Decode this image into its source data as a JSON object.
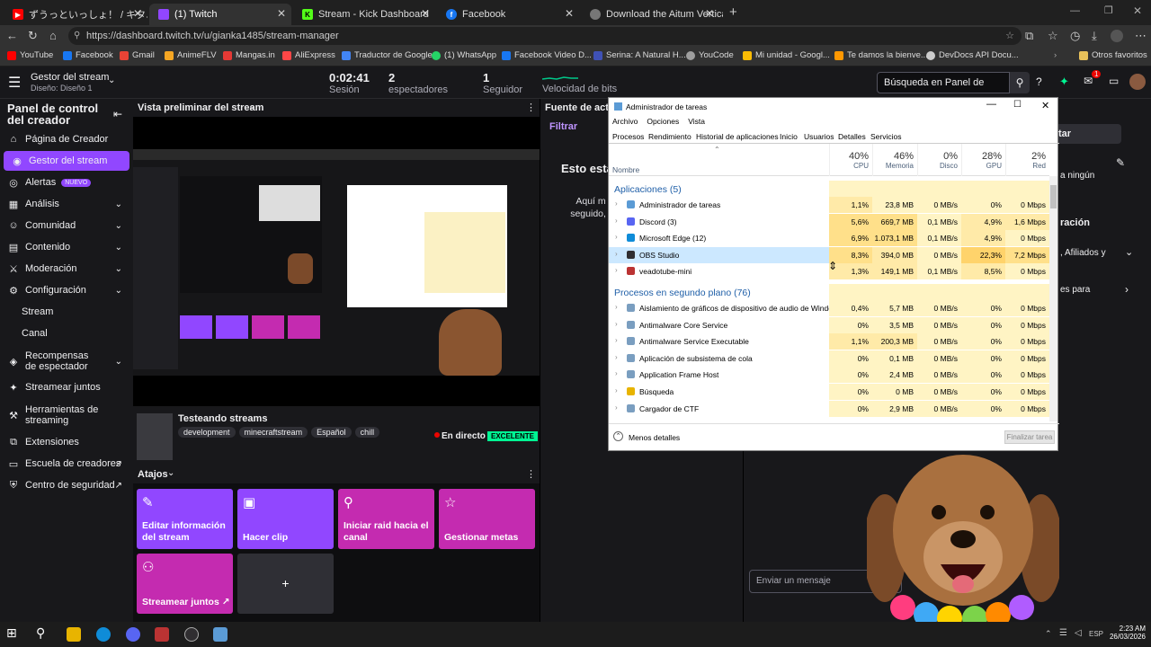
{
  "browser": {
    "tabs": [
      {
        "label": "ずうっといっしょ！ / キタニタツヤ - ALW",
        "color": "#ff0000"
      },
      {
        "label": "(1) Twitch",
        "color": "#9146ff"
      },
      {
        "label": "Stream - Kick Dashboard",
        "color": "#53fc18"
      },
      {
        "label": "Facebook",
        "color": "#1877f2"
      },
      {
        "label": "Download the Aitum Vertical Plug",
        "color": "#888888"
      }
    ],
    "url": "https://dashboard.twitch.tv/u/gianka1485/stream-manager",
    "bookmarks": [
      {
        "label": "YouTube",
        "color": "#ff0000"
      },
      {
        "label": "Facebook",
        "color": "#1877f2"
      },
      {
        "label": "Gmail",
        "color": "#ea4335"
      },
      {
        "label": "AnimeFLV",
        "color": "#f5a623"
      },
      {
        "label": "Mangas.in",
        "color": "#e53935"
      },
      {
        "label": "AliExpress",
        "color": "#ff4747"
      },
      {
        "label": "Traductor de Google",
        "color": "#4285f4"
      },
      {
        "label": "(1) WhatsApp",
        "color": "#25d366"
      },
      {
        "label": "Facebook Video D...",
        "color": "#1877f2"
      },
      {
        "label": "Serina: A Natural H...",
        "color": "#3f51b5"
      },
      {
        "label": "YouCode",
        "color": "#9e9e9e"
      },
      {
        "label": "Mi unidad - Googl...",
        "color": "#fbbc04"
      },
      {
        "label": "Te damos la bienve...",
        "color": "#ff9800"
      },
      {
        "label": "DevDocs API Docu...",
        "color": "#cccccc"
      }
    ],
    "other_bookmarks": "Otros favoritos",
    "notification_count": "1"
  },
  "topbar": {
    "title": "Gestor del stream",
    "subtitle": "Diseño: Diseño 1",
    "stats": [
      {
        "value": "0:02:41",
        "label": "Sesión"
      },
      {
        "value": "2",
        "label": "espectadores"
      },
      {
        "value": "1",
        "label": "Seguidor"
      },
      {
        "value": "",
        "label": "Velocidad de bits"
      }
    ],
    "search_placeholder": "Búsqueda en Panel de control"
  },
  "sidebar": {
    "title": "Panel de control del creador",
    "items": [
      {
        "label": "Página de Creador",
        "icon": "⌂",
        "chevron": false
      },
      {
        "label": "Gestor del stream",
        "icon": "◉",
        "chevron": false,
        "active": true
      },
      {
        "label": "Alertas",
        "icon": "◎",
        "chevron": false,
        "badge": "NUEVO"
      },
      {
        "label": "Análisis",
        "icon": "▦",
        "chevron": true
      },
      {
        "label": "Comunidad",
        "icon": "☺",
        "chevron": true
      },
      {
        "label": "Contenido",
        "icon": "▤",
        "chevron": true
      },
      {
        "label": "Moderación",
        "icon": "⚔",
        "chevron": true
      },
      {
        "label": "Configuración",
        "icon": "⚙",
        "chevron": true
      },
      {
        "label": "Stream",
        "sub": true
      },
      {
        "label": "Canal",
        "sub": true
      },
      {
        "label": "Recompensas de espectador",
        "icon": "◈",
        "chevron": true
      },
      {
        "label": "Streamear juntos",
        "icon": "✦",
        "chevron": false
      },
      {
        "label": "Herramientas de streaming",
        "icon": "⚒",
        "chevron": false
      },
      {
        "label": "Extensiones",
        "icon": "⧉",
        "chevron": false
      },
      {
        "label": "Escuela de creadores",
        "icon": "▭",
        "chevron": false,
        "external": true
      },
      {
        "label": "Centro de seguridad",
        "icon": "⛨",
        "chevron": false,
        "external": true
      }
    ]
  },
  "preview": {
    "header": "Vista preliminar del stream",
    "stream_title": "Testeando streams",
    "tags": [
      "development",
      "minecraftstream",
      "Español",
      "chill"
    ],
    "live_label": "En directo",
    "quality_badge": "EXCELENTE"
  },
  "shortcuts": {
    "header": "Atajos",
    "items": [
      {
        "label": "Editar información del stream",
        "color": "#9147ff",
        "icon": "✎"
      },
      {
        "label": "Hacer clip",
        "color": "#9147ff",
        "icon": "▣"
      },
      {
        "label": "Iniciar raid hacia el canal",
        "color": "#c42bb0",
        "icon": "⚲"
      },
      {
        "label": "Gestionar metas",
        "color": "#c42bb0",
        "icon": "☆"
      },
      {
        "label": "Streamear juntos ↗",
        "color": "#c42bb0",
        "icon": "⚇"
      }
    ],
    "add_label": "+"
  },
  "activity": {
    "header": "Fuente de activi",
    "filter": "Filtrar",
    "empty_title": "Esto está",
    "empty_body": "Aquí m seguido, t"
  },
  "chat": {
    "button": "tar",
    "line1": "a ningún",
    "line2": "ración",
    "line3": ", Afiliados y",
    "line4": "es para",
    "message_placeholder": "Enviar un mensaje"
  },
  "taskmanager": {
    "title": "Administrador de tareas",
    "menu": [
      "Archivo",
      "Opciones",
      "Vista"
    ],
    "tabs": [
      "Procesos",
      "Rendimiento",
      "Historial de aplicaciones",
      "Inicio",
      "Usuarios",
      "Detalles",
      "Servicios"
    ],
    "columns": [
      {
        "pct": "40%",
        "label": "CPU"
      },
      {
        "pct": "46%",
        "label": "Memoria"
      },
      {
        "pct": "0%",
        "label": "Disco"
      },
      {
        "pct": "28%",
        "label": "GPU"
      },
      {
        "pct": "2%",
        "label": "Red"
      }
    ],
    "name_col": "Nombre",
    "group_apps": "Aplicaciones (5)",
    "apps": [
      {
        "name": "Administrador de tareas",
        "cpu": "1,1%",
        "mem": "23,8 MB",
        "disk": "0 MB/s",
        "gpu": "0%",
        "net": "0 Mbps",
        "icon": "#5b9bd5"
      },
      {
        "name": "Discord (3)",
        "cpu": "5,6%",
        "mem": "669,7 MB",
        "disk": "0,1 MB/s",
        "gpu": "4,9%",
        "net": "1,6 Mbps",
        "icon": "#5865f2"
      },
      {
        "name": "Microsoft Edge (12)",
        "cpu": "6,9%",
        "mem": "1.073,1 MB",
        "disk": "0,1 MB/s",
        "gpu": "4,9%",
        "net": "0 Mbps",
        "icon": "#0f8cd8"
      },
      {
        "name": "OBS Studio",
        "cpu": "8,3%",
        "mem": "394,0 MB",
        "disk": "0 MB/s",
        "gpu": "22,3%",
        "net": "7,2 Mbps",
        "icon": "#302e31"
      },
      {
        "name": "veadotube-mini",
        "cpu": "1,3%",
        "mem": "149,1 MB",
        "disk": "0,1 MB/s",
        "gpu": "8,5%",
        "net": "0 Mbps",
        "icon": "#b33"
      }
    ],
    "group_bg": "Procesos en segundo plano (76)",
    "bg": [
      {
        "name": "Aislamiento de gráficos de dispositivo de audio de Windo...",
        "cpu": "0,4%",
        "mem": "5,7 MB",
        "disk": "0 MB/s",
        "gpu": "0%",
        "net": "0 Mbps",
        "icon": "#7a9ec0"
      },
      {
        "name": "Antimalware Core Service",
        "cpu": "0%",
        "mem": "3,5 MB",
        "disk": "0 MB/s",
        "gpu": "0%",
        "net": "0 Mbps",
        "icon": "#7a9ec0"
      },
      {
        "name": "Antimalware Service Executable",
        "cpu": "1,1%",
        "mem": "200,3 MB",
        "disk": "0 MB/s",
        "gpu": "0%",
        "net": "0 Mbps",
        "icon": "#7a9ec0"
      },
      {
        "name": "Aplicación de subsistema de cola",
        "cpu": "0%",
        "mem": "0,1 MB",
        "disk": "0 MB/s",
        "gpu": "0%",
        "net": "0 Mbps",
        "icon": "#7a9ec0"
      },
      {
        "name": "Application Frame Host",
        "cpu": "0%",
        "mem": "2,4 MB",
        "disk": "0 MB/s",
        "gpu": "0%",
        "net": "0 Mbps",
        "icon": "#7a9ec0"
      },
      {
        "name": "Búsqueda",
        "cpu": "0%",
        "mem": "0 MB",
        "disk": "0 MB/s",
        "gpu": "0%",
        "net": "0 Mbps",
        "icon": "#e8b400"
      },
      {
        "name": "Cargador de CTF",
        "cpu": "0%",
        "mem": "2,9 MB",
        "disk": "0 MB/s",
        "gpu": "0%",
        "net": "0 Mbps",
        "icon": "#7a9ec0"
      }
    ],
    "less_details": "Menos detalles",
    "end_task": "Finalizar tarea"
  },
  "taskbar": {
    "lang": "ESP",
    "time": "2:23 AM",
    "date": "26/03/2026"
  },
  "colors": {
    "twitch_purple": "#9147ff",
    "live_red": "#eb0400",
    "excellent_green": "#00f593",
    "heat_yellow": "#fff4c4"
  }
}
